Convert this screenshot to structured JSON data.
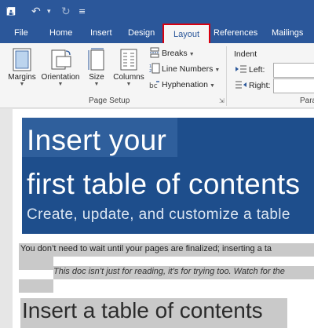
{
  "quick_access": {
    "save_icon": "save-icon",
    "undo_icon": "undo-icon",
    "redo_icon": "redo-icon",
    "customize_icon": "customize-quick-access-icon"
  },
  "tabs": [
    {
      "label": "File"
    },
    {
      "label": "Home"
    },
    {
      "label": "Insert"
    },
    {
      "label": "Design"
    },
    {
      "label": "Layout",
      "active": true
    },
    {
      "label": "References"
    },
    {
      "label": "Mailings"
    }
  ],
  "ribbon": {
    "page_setup": {
      "margins": "Margins",
      "orientation": "Orientation",
      "size": "Size",
      "columns": "Columns",
      "breaks": "Breaks",
      "line_numbers": "Line Numbers",
      "hyphenation": "Hyphenation",
      "group_label": "Page Setup"
    },
    "paragraph": {
      "indent": "Indent",
      "left": "Left:",
      "right": "Right:",
      "group_label_partial": "Para"
    }
  },
  "document": {
    "cover_title_line1": "Insert your",
    "cover_title_line2": "first table of contents",
    "cover_subtitle": "Create, update, and customize a table",
    "paragraph1": "You don’t need to wait until your pages are finalized; inserting a ta",
    "paragraph2": "This doc isn’t just for reading, it’s for trying too. Watch for the",
    "heading": "Insert a table of contents"
  },
  "colors": {
    "ribbon_blue": "#2b579a",
    "cover_blue": "#1e4e8c",
    "active_tab_outline": "#d9000f",
    "selection_gray": "#c9c9c9"
  }
}
